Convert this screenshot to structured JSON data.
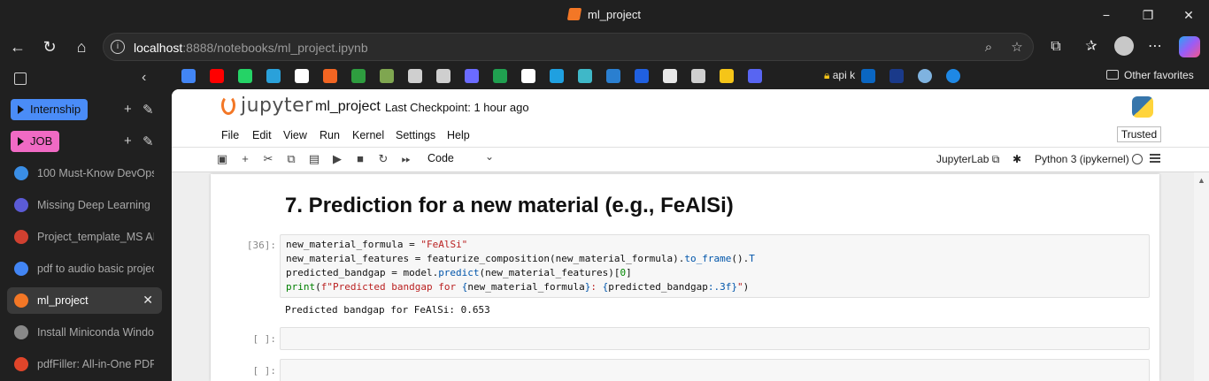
{
  "window": {
    "title": "ml_project",
    "minimize": "−",
    "maximize": "❐",
    "close": "✕"
  },
  "address_bar": {
    "host": "localhost",
    "path": ":8888/notebooks/ml_project.ipynb"
  },
  "bookmarks": {
    "items": [
      {
        "icon": "google-icon",
        "color": "#4285f4"
      },
      {
        "icon": "youtube-icon",
        "color": "#ff0000"
      },
      {
        "icon": "whatsapp-icon",
        "color": "#25d366"
      },
      {
        "icon": "telegram-icon",
        "color": "#2aa1da"
      },
      {
        "icon": "bookmark-icon",
        "color": "#ffffff"
      },
      {
        "icon": "box-icon",
        "color": "#f26522"
      },
      {
        "icon": "leaf-icon",
        "color": "#2e9d3f"
      },
      {
        "icon": "chess-icon",
        "color": "#7fa650"
      },
      {
        "icon": "globe-icon",
        "color": "#cfcfcf"
      },
      {
        "icon": "chatgpt-icon",
        "color": "#cfcfcf"
      },
      {
        "icon": "dove-icon",
        "color": "#6b6bff"
      },
      {
        "icon": "w-icon",
        "color": "#20a050"
      },
      {
        "icon": "github-icon",
        "color": "#ffffff"
      },
      {
        "icon": "k-icon",
        "color": "#1fa0e0"
      },
      {
        "icon": "eye-icon",
        "color": "#3fb8c8"
      },
      {
        "icon": "t-icon",
        "color": "#2a7fd0"
      },
      {
        "icon": "c-icon",
        "color": "#2060e0"
      },
      {
        "icon": "monitor-icon",
        "color": "#e8e8e8"
      },
      {
        "icon": "grid-icon",
        "color": "#cfcfcf"
      },
      {
        "icon": "emoji-icon",
        "color": "#f5c518"
      },
      {
        "icon": "discord-icon",
        "color": "#5865f2"
      }
    ],
    "apik_label": "api k",
    "other_favorites": "Other favorites"
  },
  "sidebar": {
    "groups": [
      {
        "label": "Internship",
        "color": "#4a8cf7"
      },
      {
        "label": "JOB",
        "color": "#f06ac4"
      }
    ],
    "tabs": [
      {
        "label": "100 Must-Know DevOps",
        "favcolor": "#3a8ee6",
        "active": false
      },
      {
        "label": "Missing Deep Learning F",
        "favcolor": "#5b5bd6",
        "active": false
      },
      {
        "label": "Project_template_MS AI",
        "favcolor": "#d04030",
        "active": false
      },
      {
        "label": "pdf to audio basic projec",
        "favcolor": "#4285f4",
        "active": false
      },
      {
        "label": "ml_project",
        "favcolor": "#f37726",
        "active": true
      },
      {
        "label": "Install Miniconda Windo",
        "favcolor": "#888888",
        "active": false
      },
      {
        "label": "pdfFiller: All-in-One PDF",
        "favcolor": "#e0452a",
        "active": false
      }
    ]
  },
  "jupyter": {
    "logo_text": "jupyter",
    "notebook_name": "ml_project",
    "checkpoint": "Last Checkpoint: 1 hour ago",
    "menu": [
      "File",
      "Edit",
      "View",
      "Run",
      "Kernel",
      "Settings",
      "Help"
    ],
    "trusted": "Trusted",
    "cell_type": "Code",
    "jupyterlab_label": "JupyterLab",
    "kernel_label": "Python 3 (ipykernel)",
    "heading": "7. Prediction for a new material (e.g., FeAlSi)",
    "cell1_prompt": "[36]:",
    "output_text": "Predicted bandgap for FeAlSi: 0.653",
    "empty_prompt": "[ ]:"
  }
}
